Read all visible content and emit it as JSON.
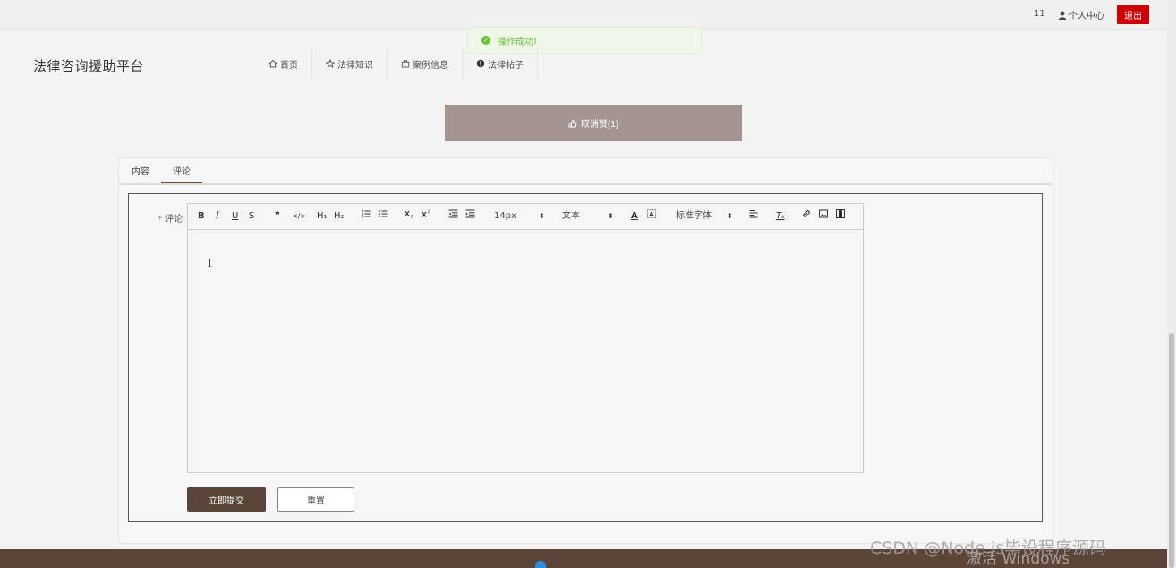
{
  "topbar": {
    "count": "11",
    "user_label": "个人中心",
    "logout_label": "退出"
  },
  "ghost_text": "",
  "toast": {
    "message": "操作成功!"
  },
  "brand": "法律咨询援助平台",
  "nav": [
    {
      "label": "首页",
      "icon": "home-icon"
    },
    {
      "label": "法律知识",
      "icon": "star-icon"
    },
    {
      "label": "案例信息",
      "icon": "bag-icon"
    },
    {
      "label": "法律帖子",
      "icon": "exclamation-icon"
    }
  ],
  "action": {
    "label": "取消赞(1)"
  },
  "tabs": [
    {
      "label": "内容"
    },
    {
      "label": "评论"
    }
  ],
  "form": {
    "field_label": "评论",
    "required_mark": "*",
    "toolbar": {
      "bold": "B",
      "italic": "I",
      "underline": "U",
      "strike": "S",
      "quote": "❞",
      "code": "</>",
      "h1": "H₁",
      "h2": "H₂",
      "size": "14px",
      "type": "文本",
      "font": "标准字体"
    },
    "submit_label": "立即提交",
    "reset_label": "重置"
  },
  "watermark": "CSDN @Node.js毕设程序源码",
  "os_watermark": "激活 Windows"
}
